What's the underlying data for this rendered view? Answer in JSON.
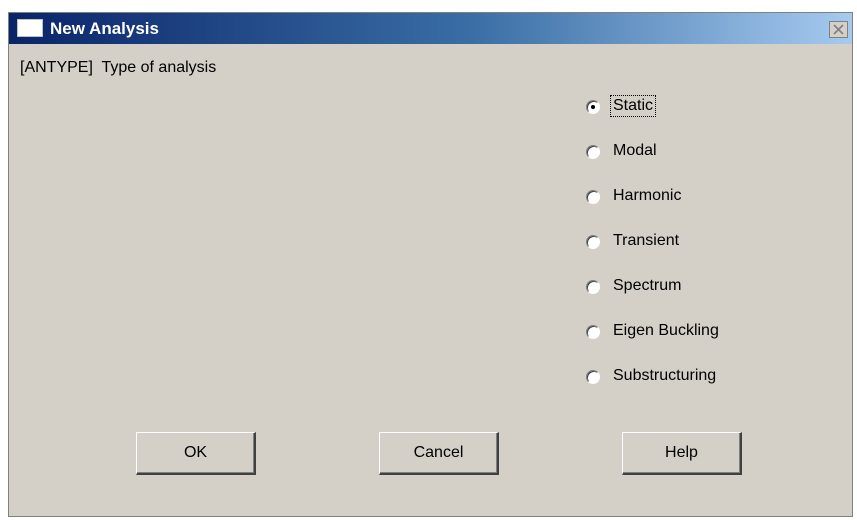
{
  "window": {
    "title": "New Analysis",
    "close_icon": "close-icon",
    "title_icon": "window-icon"
  },
  "antype_label": "[ANTYPE]  Type of analysis",
  "analysis_types": [
    {
      "label": "Static",
      "selected": true
    },
    {
      "label": "Modal",
      "selected": false
    },
    {
      "label": "Harmonic",
      "selected": false
    },
    {
      "label": "Transient",
      "selected": false
    },
    {
      "label": "Spectrum",
      "selected": false
    },
    {
      "label": "Eigen Buckling",
      "selected": false
    },
    {
      "label": "Substructuring",
      "selected": false
    }
  ],
  "buttons": {
    "ok": "OK",
    "cancel": "Cancel",
    "help": "Help"
  },
  "colors": {
    "dialog_bg": "#d4d0c8",
    "titlebar_start": "#0a246a",
    "titlebar_end": "#a6caf0"
  }
}
